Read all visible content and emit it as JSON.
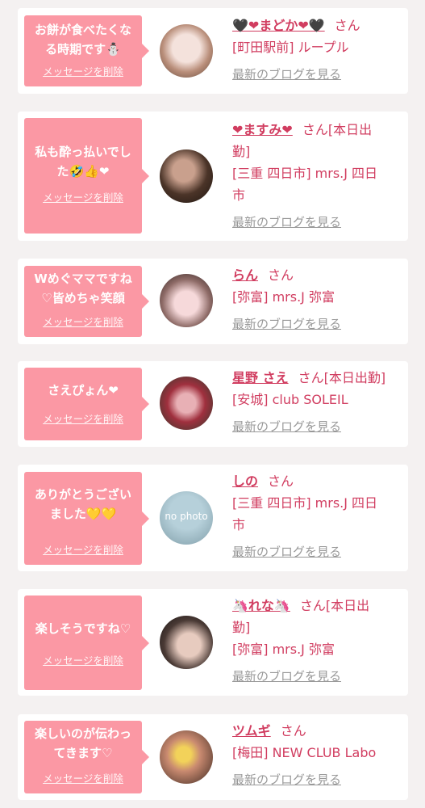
{
  "delete_label": "メッセージを削除",
  "blog_label": "最新のブログを見る",
  "san_label": "さん",
  "cards": [
    {
      "message": [
        "お餅が食べたくな",
        "る時期です⛄"
      ],
      "name": "🖤❤まどか❤🖤",
      "status": "",
      "location": [
        "[町田駅前] ループル"
      ]
    },
    {
      "message": [
        "私も酔っ払いでし",
        "た🤣👍❤"
      ],
      "name": "❤ますみ❤",
      "status": "[本日出",
      "location": [
        "勤]",
        "[三重 四日市] mrs.J 四日",
        "市"
      ]
    },
    {
      "message": [
        "Wめぐママですね",
        "♡皆めちゃ笑顔"
      ],
      "name": "らん",
      "status": "",
      "location": [
        "[弥富] mrs.J 弥富"
      ]
    },
    {
      "message": [
        "さえぴょん❤"
      ],
      "name": "星野 さえ",
      "status": "[本日出勤]",
      "location": [
        "[安城] club SOLEIL"
      ]
    },
    {
      "message": [
        "ありがとうござい",
        "ました💛💛"
      ],
      "name": "しの",
      "status": "",
      "location": [
        "[三重 四日市] mrs.J 四日",
        "市"
      ],
      "avatar_text": "no photo"
    },
    {
      "message": [
        "楽しそうですね♡"
      ],
      "name": "🦄れな🦄",
      "status": "[本日出",
      "location": [
        "勤]",
        "[弥富] mrs.J 弥富"
      ]
    },
    {
      "message": [
        "楽しいのが伝わっ",
        "てきます♡"
      ],
      "name": "ツムギ",
      "status": "",
      "location": [
        "[梅田] NEW CLUB Labo"
      ]
    }
  ],
  "colors": {
    "accent": "#d13d60",
    "bubble": "#fb98a4",
    "background": "#f4f1f1"
  }
}
